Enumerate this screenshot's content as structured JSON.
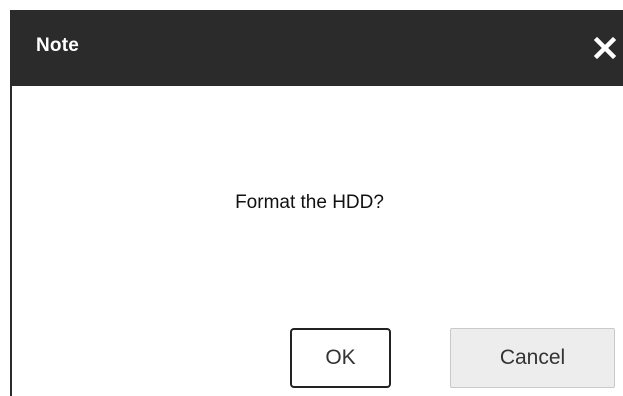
{
  "dialog": {
    "title": "Note",
    "close_icon": "close-icon",
    "message": "Format the HDD?",
    "buttons": {
      "ok_label": "OK",
      "cancel_label": "Cancel"
    }
  },
  "colors": {
    "title_bar": "#2b2b2b",
    "title_text": "#ffffff",
    "cancel_bg": "#ededed",
    "ok_border": "#222222"
  }
}
